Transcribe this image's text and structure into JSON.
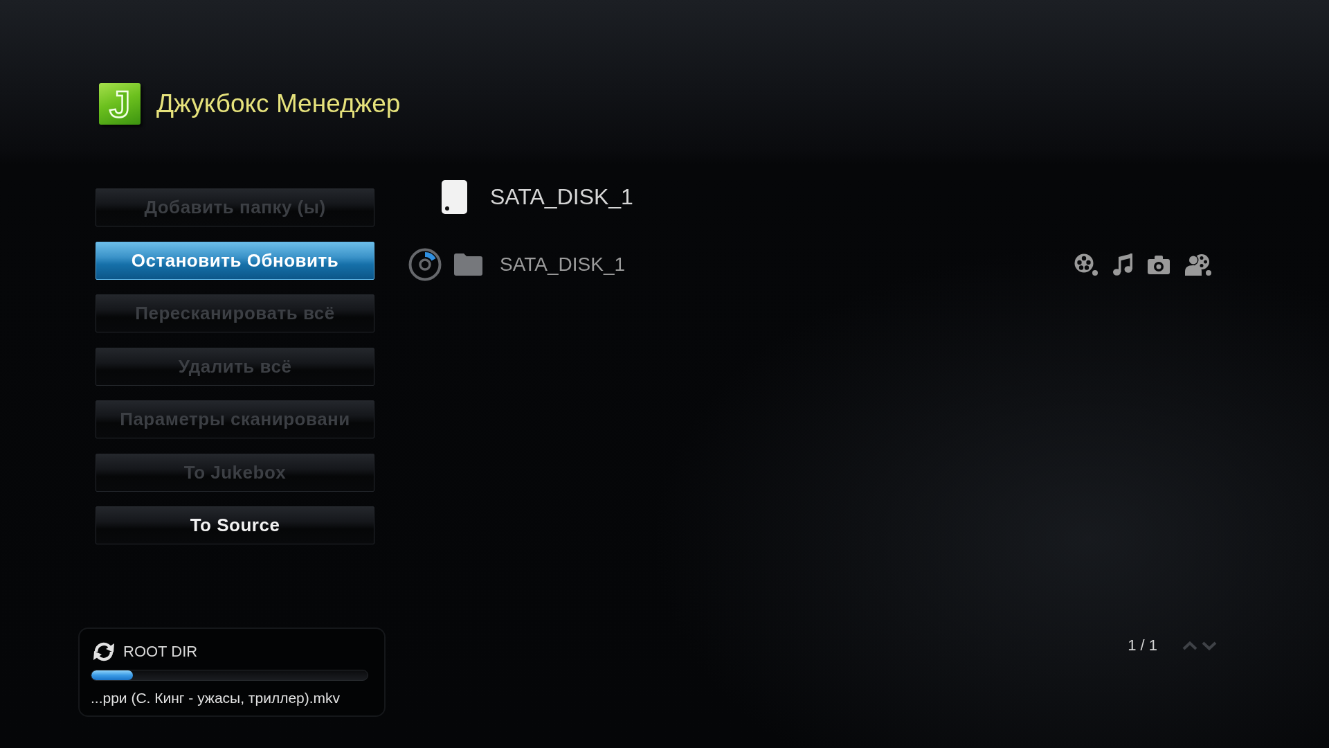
{
  "header": {
    "logo_letter": "J",
    "title": "Джукбокс Менеджер"
  },
  "menu": [
    {
      "label": "Добавить папку (ы)",
      "selected": false,
      "disabled": true
    },
    {
      "label": "Остановить Обновить",
      "selected": true,
      "disabled": false
    },
    {
      "label": "Пересканировать всё",
      "selected": false,
      "disabled": true
    },
    {
      "label": "Удалить всё",
      "selected": false,
      "disabled": true
    },
    {
      "label": "Параметры сканировани",
      "selected": false,
      "disabled": true
    },
    {
      "label": "To Jukebox",
      "selected": false,
      "disabled": true
    },
    {
      "label": "To Source",
      "selected": false,
      "disabled": false
    }
  ],
  "device": {
    "name": "SATA_DISK_1"
  },
  "folders": [
    {
      "name": "SATA_DISK_1"
    }
  ],
  "pager": {
    "page": "1 / 1"
  },
  "scan_status": {
    "folder": "ROOT DIR",
    "level": 0.15,
    "file": "...рри (С. Кинг - ужасы, триллер).mkv"
  }
}
